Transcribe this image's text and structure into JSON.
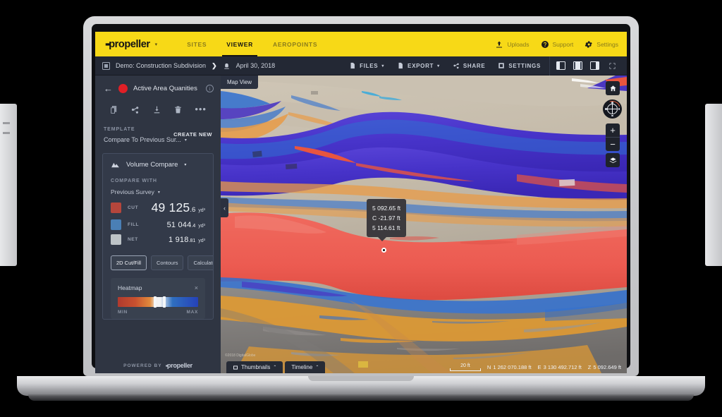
{
  "topnav": {
    "brand": "propeller",
    "brand_caret": "▾",
    "tabs": [
      {
        "label": "SITES",
        "active": false
      },
      {
        "label": "VIEWER",
        "active": true
      },
      {
        "label": "AEROPOINTS",
        "active": false
      }
    ],
    "right": [
      {
        "label": "Uploads",
        "icon": "upload-icon"
      },
      {
        "label": "Support",
        "icon": "help-circle-icon"
      },
      {
        "label": "Settings",
        "icon": "gear-icon"
      }
    ]
  },
  "toolbar": {
    "breadcrumb_site": "Demo: Construction Subdivision",
    "breadcrumb_sep": "❯",
    "breadcrumb_date": "April 30, 2018",
    "buttons": [
      {
        "label": "FILES",
        "caret": "▾",
        "icon": "file-icon"
      },
      {
        "label": "EXPORT",
        "caret": "▾",
        "icon": "export-icon"
      },
      {
        "label": "SHARE",
        "caret": "",
        "icon": "share-icon"
      },
      {
        "label": "SETTINGS",
        "caret": "",
        "icon": "settings-square-icon"
      }
    ],
    "layout_icons": [
      "panel-left-icon",
      "panel-split-icon",
      "panel-right-icon"
    ],
    "fullscreen_icon": "fullscreen-icon"
  },
  "sidebar": {
    "back_arrow": "←",
    "title": "Active Area Quanities",
    "dot_color": "#e01f26",
    "info_icon": "i",
    "actions": [
      "copy-icon",
      "share-icon",
      "download-icon",
      "delete-icon",
      "more-icon"
    ],
    "template_label": "TEMPLATE",
    "template_value": "Compare To Previous Sur...",
    "template_caret": "▾",
    "create_new": "CREATE NEW",
    "card": {
      "title": "Volume Compare",
      "caret": "▾",
      "icon": "mountain-icon",
      "compare_with_label": "COMPARE WITH",
      "compare_with_value": "Previous Survey",
      "compare_with_caret": "▾",
      "metrics": [
        {
          "name": "CUT",
          "int": "49 125",
          "dec": ".6",
          "unit": "yd³",
          "color": "#b5463c",
          "size": "big"
        },
        {
          "name": "FILL",
          "int": "51 044",
          "dec": ".4",
          "unit": "yd³",
          "color": "#4a7fb5",
          "size": "sm"
        },
        {
          "name": "NET",
          "int": "1 918",
          "dec": ".81",
          "unit": "yd³",
          "color": "#bdc3c7",
          "size": "sm"
        }
      ],
      "buttons": [
        {
          "label": "2D Cut/Fill",
          "active": true
        },
        {
          "label": "Contours",
          "active": false
        },
        {
          "label": "Calculator",
          "active": false
        }
      ],
      "heatmap": {
        "title": "Heatmap",
        "close": "×",
        "min_label": "MIN",
        "max_label": "MAX"
      }
    },
    "powered_by": "POWERED BY",
    "powered_brand": "propeller"
  },
  "map": {
    "view_tab": "Map View",
    "collapse": "‹",
    "controls": [
      {
        "name": "home-icon"
      },
      {
        "name": "compass-icon"
      },
      {
        "name": "zoom-in-icon",
        "label": "+"
      },
      {
        "name": "zoom-out-icon",
        "label": "−"
      },
      {
        "name": "layers-icon"
      }
    ],
    "attribution": "©2018  DigitalGlobe",
    "tooltip": {
      "line1": "5 092.65 ft",
      "line2": "C -21.97 ft",
      "line3": "5 114.61 ft"
    },
    "bottom_tabs": [
      {
        "label": "Thumbnails",
        "caret": "⌃",
        "icon": "thumbnails-icon"
      },
      {
        "label": "Timeline",
        "caret": "⌃",
        "icon": ""
      }
    ],
    "scale_label": "20 ft",
    "coords": [
      {
        "axis": "N",
        "value": "1 262 070.188 ft"
      },
      {
        "axis": "E",
        "value": "3 130 492.712 ft"
      },
      {
        "axis": "Z",
        "value": "5 092.649 ft"
      }
    ]
  }
}
